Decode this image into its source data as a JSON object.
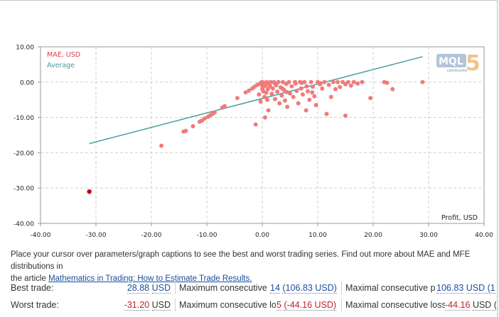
{
  "chart_data": {
    "type": "scatter",
    "xlabel": "Profit, USD",
    "ylabel": "",
    "xlim": [
      -40,
      40
    ],
    "ylim": [
      -40,
      10
    ],
    "x_ticks": [
      "-40.00",
      "-30.00",
      "-20.00",
      "-10.00",
      "0.00",
      "10.00",
      "20.00",
      "30.00",
      "40.00"
    ],
    "y_ticks": [
      "10.00",
      "0.00",
      "-10.00",
      "-20.00",
      "-30.00",
      "-40.00"
    ],
    "grid": true,
    "legend_position": "top-left",
    "series": [
      {
        "name": "MAE, USD",
        "color": "#f07b7b",
        "points": [
          [
            -18.2,
            -18.0
          ],
          [
            -14.2,
            -14.0
          ],
          [
            -13.8,
            -13.8
          ],
          [
            -12.5,
            -12.5
          ],
          [
            -11.3,
            -11.2
          ],
          [
            -10.9,
            -10.9
          ],
          [
            -10.4,
            -10.3
          ],
          [
            -9.8,
            -9.8
          ],
          [
            -9.4,
            -9.4
          ],
          [
            -9.0,
            -9.0
          ],
          [
            -8.6,
            -8.6
          ],
          [
            -7.2,
            -7.2
          ],
          [
            -6.8,
            -6.8
          ],
          [
            -4.5,
            -4.5
          ],
          [
            -3.0,
            -2.9
          ],
          [
            -2.4,
            -2.4
          ],
          [
            -1.8,
            -1.8
          ],
          [
            -1.4,
            -1.3
          ],
          [
            -1.2,
            -12.0
          ],
          [
            -0.9,
            -0.8
          ],
          [
            -0.6,
            -3.5
          ],
          [
            -0.4,
            -0.4
          ],
          [
            -0.3,
            -5.5
          ],
          [
            -0.2,
            -0.1
          ],
          [
            0.0,
            0.0
          ],
          [
            0.1,
            -1.5
          ],
          [
            0.2,
            -2.6
          ],
          [
            0.3,
            -0.2
          ],
          [
            0.4,
            -4.2
          ],
          [
            0.5,
            -10.0
          ],
          [
            0.6,
            -1.0
          ],
          [
            0.7,
            -3.0
          ],
          [
            0.8,
            0.0
          ],
          [
            0.9,
            -5.0
          ],
          [
            1.0,
            -2.0
          ],
          [
            1.1,
            -8.0
          ],
          [
            1.3,
            -0.6
          ],
          [
            1.5,
            0.0
          ],
          [
            1.7,
            -3.3
          ],
          [
            1.9,
            -1.8
          ],
          [
            2.1,
            0.0
          ],
          [
            2.3,
            -4.8
          ],
          [
            2.5,
            -0.9
          ],
          [
            2.7,
            -2.7
          ],
          [
            2.9,
            0.0
          ],
          [
            3.1,
            -6.0
          ],
          [
            3.3,
            -1.5
          ],
          [
            3.5,
            -3.8
          ],
          [
            3.7,
            0.0
          ],
          [
            3.9,
            -2.2
          ],
          [
            4.1,
            -5.2
          ],
          [
            4.3,
            -0.5
          ],
          [
            4.5,
            -7.0
          ],
          [
            4.8,
            0.0
          ],
          [
            5.0,
            -3.2
          ],
          [
            5.3,
            -1.2
          ],
          [
            5.6,
            -4.2
          ],
          [
            5.9,
            0.0
          ],
          [
            6.2,
            -2.5
          ],
          [
            6.5,
            -6.0
          ],
          [
            6.8,
            0.0
          ],
          [
            7.0,
            -1.8
          ],
          [
            7.3,
            -3.5
          ],
          [
            7.6,
            0.0
          ],
          [
            7.9,
            -8.0
          ],
          [
            8.2,
            -2.6
          ],
          [
            8.5,
            -5.0
          ],
          [
            8.8,
            0.0
          ],
          [
            9.1,
            -1.3
          ],
          [
            9.4,
            -4.0
          ],
          [
            9.7,
            -6.5
          ],
          [
            10.0,
            0.0
          ],
          [
            10.4,
            -0.6
          ],
          [
            10.8,
            -1.8
          ],
          [
            11.2,
            0.0
          ],
          [
            11.6,
            -9.0
          ],
          [
            12.0,
            -0.8
          ],
          [
            12.4,
            -4.2
          ],
          [
            12.8,
            0.0
          ],
          [
            13.2,
            -2.0
          ],
          [
            13.6,
            0.0
          ],
          [
            14.0,
            -1.4
          ],
          [
            14.5,
            0.0
          ],
          [
            15.0,
            -0.6
          ],
          [
            15.5,
            0.0
          ],
          [
            16.0,
            -1.0
          ],
          [
            16.5,
            0.0
          ],
          [
            17.2,
            -0.4
          ],
          [
            18.0,
            0.0
          ],
          [
            19.5,
            -4.5
          ],
          [
            22.0,
            0.0
          ],
          [
            22.5,
            -0.2
          ],
          [
            23.5,
            -2.0
          ],
          [
            15.0,
            -9.5
          ],
          [
            28.9,
            0.0
          ],
          [
            0.0,
            -1.0
          ],
          [
            0.0,
            -2.0
          ],
          [
            1.4,
            -1.2
          ],
          [
            2.2,
            -0.3
          ],
          [
            3.6,
            -1.8
          ],
          [
            4.4,
            -2.8
          ],
          [
            6.0,
            -0.4
          ],
          [
            7.1,
            -0.2
          ],
          [
            8.0,
            -1.2
          ],
          [
            9.0,
            -2.9
          ],
          [
            10.5,
            -0.3
          ]
        ]
      },
      {
        "name": "worst-trade",
        "color": "#c0000e",
        "points": [
          [
            -31.2,
            -31.0
          ]
        ]
      },
      {
        "name": "Average",
        "color": "#4a9a9a",
        "line": [
          [
            -31.2,
            -17.4
          ],
          [
            28.9,
            7.2
          ]
        ]
      }
    ]
  },
  "logo": {
    "text_mql": "MQL",
    "text_digit": "5",
    "text_sub": "community"
  },
  "info": {
    "line1": "Place your cursor over parameters/graph captions to see the best and worst trading series. Find out more about MAE and MFE distributions in",
    "line2_prefix": "the article ",
    "link": "Mathematics in Trading: How to Estimate Trade Results."
  },
  "stats": {
    "row1": {
      "label": "Best trade:",
      "value": "28.88",
      "unit": "USD",
      "col2_label": "Maximum consecutive w",
      "col2_count": "14",
      "col2_value": "(106.83 USD)",
      "col3_label": "Maximal consecutive pr",
      "col3_value": "106.83",
      "col3_extra": "USD (1"
    },
    "row2": {
      "label": "Worst trade:",
      "value": "-31.20",
      "unit": "USD",
      "col2_label": "Maximum consecutive los",
      "col2_count": "5",
      "col2_value": "(-44.16 USD)",
      "col3_label": "Maximal consecutive loss:",
      "col3_value": "-44.16",
      "col3_extra": "USD ("
    }
  }
}
